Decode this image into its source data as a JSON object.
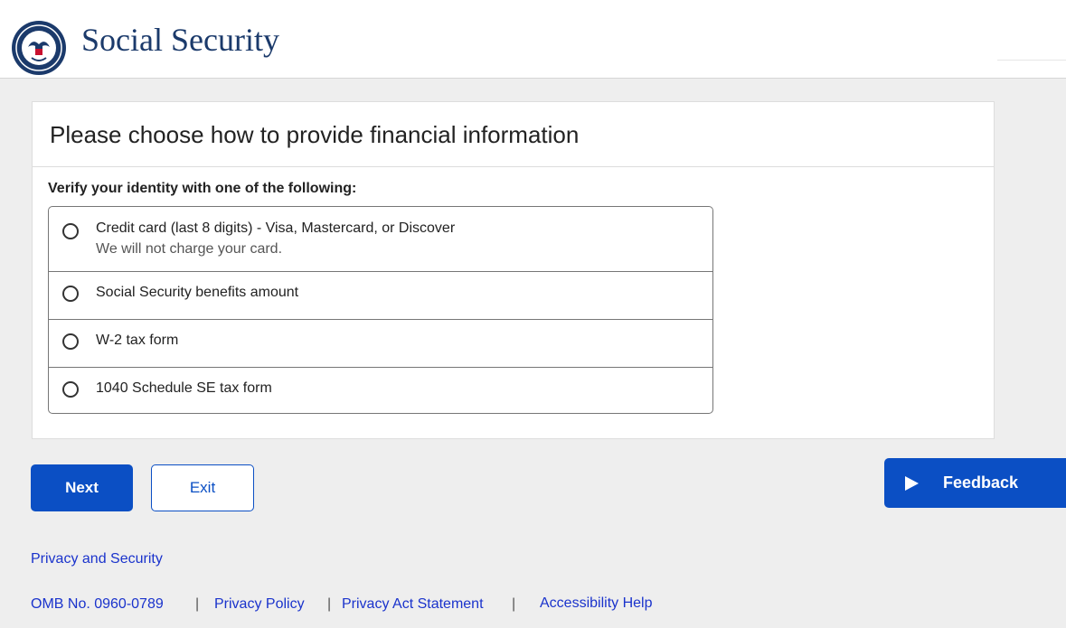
{
  "header": {
    "brand": "Social Security",
    "logo_icon": "ssa-seal-icon"
  },
  "card": {
    "title": "Please choose how to provide financial information",
    "legend": "Verify your identity with one of the following:",
    "options": [
      {
        "label": "Credit card (last 8 digits)",
        "label_suffix": " - Visa, Mastercard, or Discover",
        "sub": "We will not charge your card.",
        "selected": false
      },
      {
        "label": "Social Security benefits amount",
        "selected": false
      },
      {
        "label": "W-2 tax form",
        "selected": false
      },
      {
        "label": "1040 Schedule SE tax form",
        "selected": false
      }
    ]
  },
  "actions": {
    "next": "Next",
    "exit": "Exit",
    "feedback": "Feedback"
  },
  "footer": {
    "privacy_security": "Privacy and Security",
    "omb": "OMB No. 0960-0789",
    "privacy_policy": "Privacy Policy",
    "privacy_act": "Privacy Act Statement",
    "accessibility": "Accessibility Help",
    "separator": "|"
  },
  "colors": {
    "primary": "#0b4fc4",
    "brand_text": "#1b3a6b",
    "link": "#1a33cc",
    "page_background": "#eeeeee"
  }
}
